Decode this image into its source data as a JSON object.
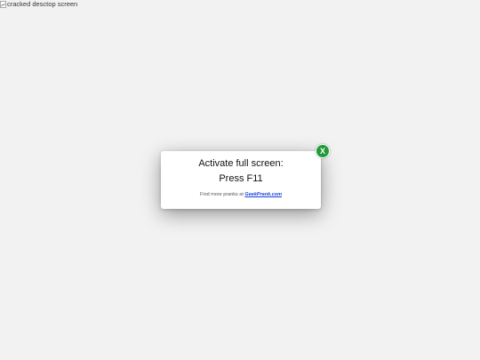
{
  "background": {
    "image_alt": "cracked desctop screen",
    "color": "#f2f2f2"
  },
  "dialog": {
    "line1": "Activate full screen:",
    "line2": "Press F11",
    "footer_prefix": "Find more pranks at ",
    "footer_link": "GeekPrank.com",
    "close_label": "X",
    "close_color": "#1e9a3a",
    "link_color": "#1a3fd9"
  }
}
